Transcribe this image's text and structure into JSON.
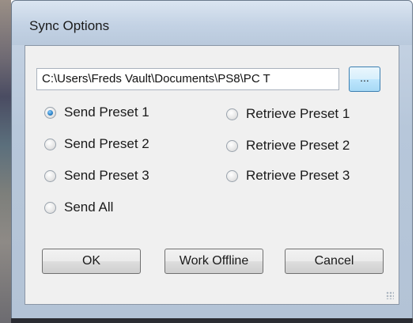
{
  "window": {
    "title": "Sync Options"
  },
  "path": {
    "value": "C:\\Users\\Freds Vault\\Documents\\PS8\\PC T"
  },
  "browse": {
    "label": "..."
  },
  "radios": {
    "send1": {
      "label": "Send Preset 1",
      "checked": true
    },
    "send2": {
      "label": "Send Preset 2",
      "checked": false
    },
    "send3": {
      "label": "Send Preset 3",
      "checked": false
    },
    "sendAll": {
      "label": "Send All",
      "checked": false
    },
    "retrieve1": {
      "label": "Retrieve Preset 1",
      "checked": false
    },
    "retrieve2": {
      "label": "Retrieve Preset 2",
      "checked": false
    },
    "retrieve3": {
      "label": "Retrieve Preset 3",
      "checked": false
    }
  },
  "buttons": {
    "ok": "OK",
    "work_offline": "Work Offline",
    "cancel": "Cancel"
  },
  "colors": {
    "accent": "#2a7fc4",
    "dialog_bg": "#f0f0f0",
    "frame": "#b7c7da"
  }
}
